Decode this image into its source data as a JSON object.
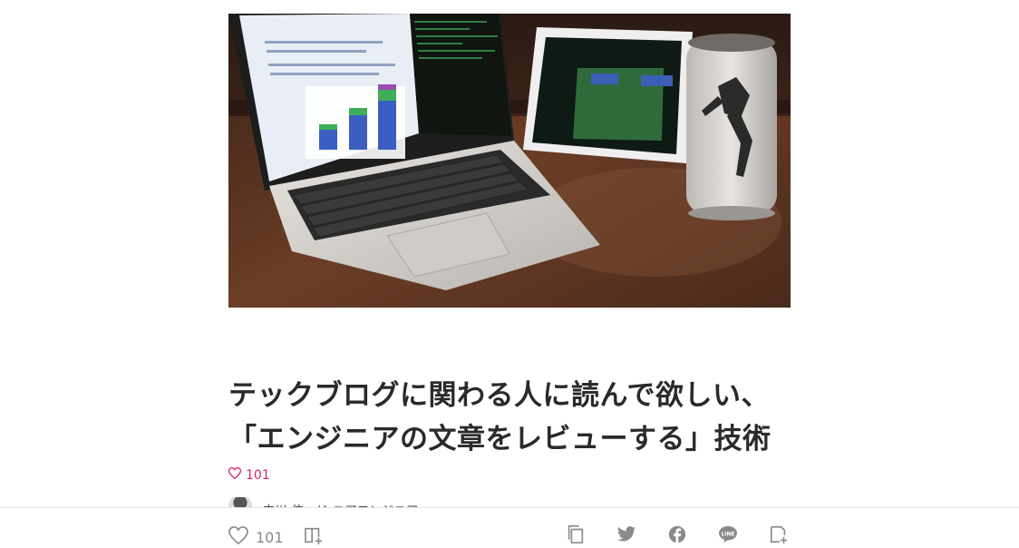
{
  "article": {
    "title_line1": "テックブログに関わる人に読んで欲しい、",
    "title_line2": "「エンジニアの文章をレビューする」技術",
    "like_count": "101"
  },
  "author": {
    "name": "中川 伸一/シニアエンジニア"
  },
  "bottom_bar": {
    "like_count": "101"
  },
  "icons": [
    "heart-icon",
    "magazine-add-icon",
    "copy-link-icon",
    "twitter-icon",
    "facebook-icon",
    "line-icon",
    "clip-icon"
  ],
  "colors": {
    "like_accent": "#e0245e",
    "muted": "#8a8a8a"
  }
}
